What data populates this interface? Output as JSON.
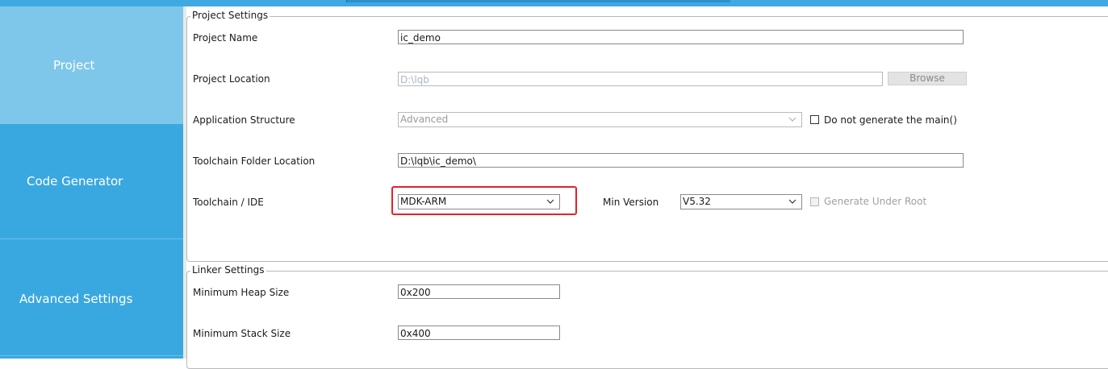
{
  "nav": {
    "items": [
      {
        "label": "Project",
        "active": true
      },
      {
        "label": "Code Generator",
        "active": false
      },
      {
        "label": "Advanced Settings",
        "active": false
      }
    ]
  },
  "project_settings": {
    "legend": "Project Settings",
    "project_name": {
      "label": "Project Name",
      "value": "ic_demo"
    },
    "project_location": {
      "label": "Project Location",
      "value": "D:\\lqb",
      "browse_label": "Browse"
    },
    "application_structure": {
      "label": "Application Structure",
      "value": "Advanced",
      "checkbox_label": "Do not generate the main()",
      "checked": false
    },
    "toolchain_folder": {
      "label": "Toolchain Folder Location",
      "value": "D:\\lqb\\ic_demo\\"
    },
    "toolchain_ide": {
      "label": "Toolchain / IDE",
      "value": "MDK-ARM",
      "min_version_label": "Min Version",
      "min_version_value": "V5.32",
      "generate_root_label": "Generate Under Root",
      "generate_root_checked": false
    }
  },
  "linker_settings": {
    "legend": "Linker Settings",
    "heap": {
      "label": "Minimum Heap Size",
      "value": "0x200"
    },
    "stack": {
      "label": "Minimum Stack Size",
      "value": "0x400"
    }
  },
  "colors": {
    "nav_bg": "#3aa8e0",
    "nav_active": "#7ec7ea",
    "highlight": "#e8202a"
  }
}
